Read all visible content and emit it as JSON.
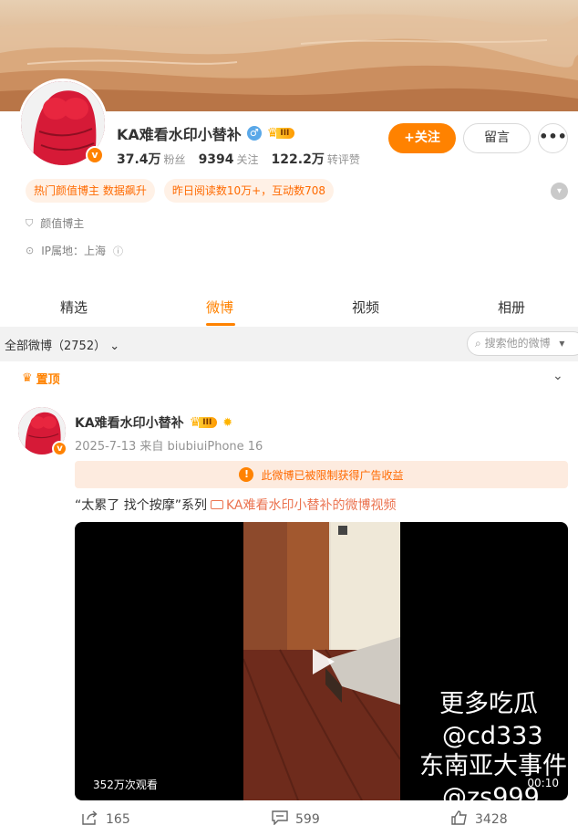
{
  "profile": {
    "name": "KA难看水印小替补",
    "verified_badge": "v",
    "gender_icon": "male-icon",
    "level": "III",
    "stats": [
      {
        "num": "37.4万",
        "label": "粉丝"
      },
      {
        "num": "9394",
        "label": "关注"
      },
      {
        "num": "122.2万",
        "label": "转评赞"
      }
    ],
    "follow_label": "+关注",
    "message_label": "留言",
    "more_label": "•••",
    "tags": [
      "热门颜值博主 数据飙升",
      "昨日阅读数10万+，互动数708"
    ],
    "category": "颜值博主",
    "ip": "IP属地：上海"
  },
  "tabs": [
    {
      "label": "精选",
      "active": false
    },
    {
      "label": "微博",
      "active": true
    },
    {
      "label": "视频",
      "active": false
    },
    {
      "label": "相册",
      "active": false
    }
  ],
  "filter": {
    "label": "全部微博（2752）",
    "search_placeholder": "搜索他的微博"
  },
  "pinned_label": "置顶",
  "post": {
    "author": "KA难看水印小替补",
    "level": "III",
    "meta": "2025-7-13  来自 biubiuiPhone 16",
    "notice": "此微博已被限制获得广告收益",
    "text_prefix": "“太累了 找个按摩”系列",
    "link_text": "KA难看水印小替补的微博视频",
    "video": {
      "views": "352万次观看",
      "duration": "00:10",
      "watermark": [
        "更多吃瓜",
        "@cd333",
        "东南亚大事件",
        "@zs999"
      ]
    },
    "actions": [
      {
        "icon": "share-icon",
        "count": "165"
      },
      {
        "icon": "comment-icon",
        "count": "599"
      },
      {
        "icon": "like-icon",
        "count": "3428"
      }
    ]
  },
  "colors": {
    "accent": "#ff8200",
    "link": "#eb7350",
    "tag_bg": "#fff1e6",
    "notice_bg": "#fdebdf"
  }
}
